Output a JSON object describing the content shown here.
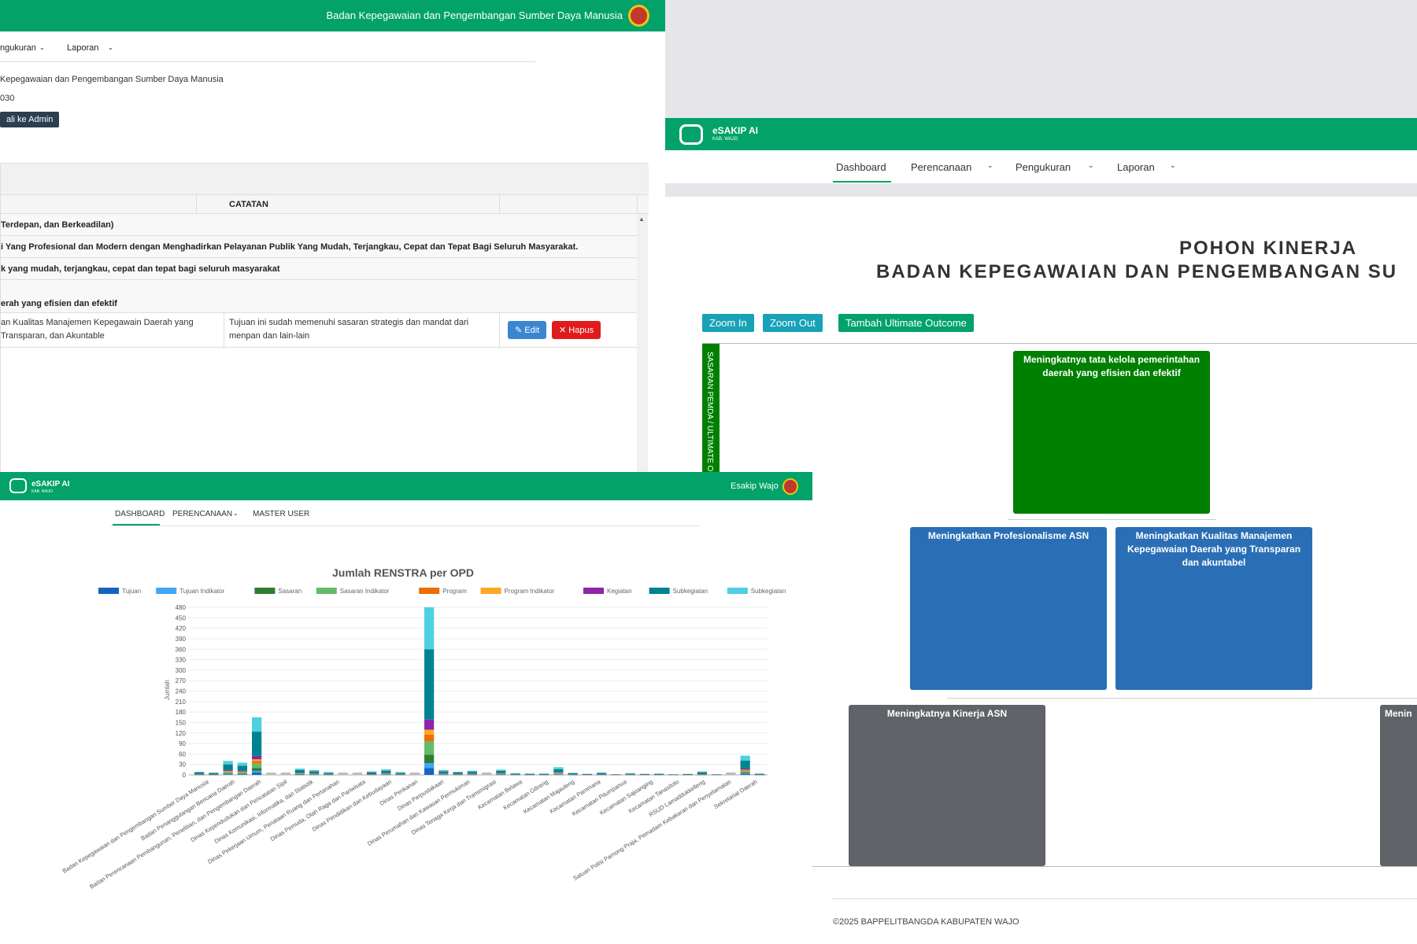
{
  "win1": {
    "brand_title": "Badan Kepegawaian dan Pengembangan Sumber Daya Manusia",
    "nav": [
      "ngukuran",
      "Laporan"
    ],
    "info_org": "Kepegawaian dan Pengembangan Sumber Daya Manusia",
    "info_year": "030",
    "back_button": "ali ke Admin",
    "col_catatan": "CATATAN",
    "rows": [
      "Terdepan, dan Berkeadilan)",
      "i Yang Profesional dan Modern dengan Menghadirkan Pelayanan Publik Yang Mudah, Terjangkau, Cepat dan Tepat Bagi Seluruh Masyarakat.",
      "k yang mudah, terjangkau, cepat dan tepat bagi seluruh masyarakat",
      "erah yang efisien dan efektif"
    ],
    "detail_left_1": "an Kualitas Manajemen Kepegawain Daerah yang",
    "detail_left_2": "Transparan, dan Akuntable",
    "detail_note_1": "Tujuan ini sudah memenuhi sasaran strategis dan mandat dari",
    "detail_note_2": "menpan dan lain-lain",
    "edit_label": "Edit",
    "delete_label": "Hapus"
  },
  "win2": {
    "logo": "eSAKIP AI",
    "logo_sub": "KAB. WAJO",
    "nav": [
      "Dashboard",
      "Perencanaan",
      "Pengukuran",
      "Laporan"
    ],
    "title_1": "POHON KINERJA",
    "title_2": "BADAN KEPEGAWAIAN DAN PENGEMBANGAN SU",
    "zoom_in": "Zoom In",
    "zoom_out": "Zoom Out",
    "add_outcome": "Tambah Ultimate Outcome",
    "vertical_label": "SASARAN PEMDA / ULTIMATE O",
    "node_root": "Meningkatnya tata kelola pemerintahan daerah yang efisien dan efektif",
    "node_a": "Meningkatkan Profesionalisme ASN",
    "node_b": "Meningkatkan Kualitas Manajemen Kepegawaian Daerah yang Transparan dan akuntabel",
    "node_c": "Meningkatnya Kinerja ASN",
    "node_d": "Menin",
    "footer": "©2025 BAPPELITBANGDA KABUPATEN WAJO",
    "colors": {
      "green": "#02a26a",
      "root": "#008000",
      "blue": "#2a6fb5",
      "gray": "#5f6368"
    }
  },
  "win3": {
    "logo": "eSAKIP AI",
    "logo_sub": "KAB. WAJO",
    "user": "Esakip Wajo",
    "menu": [
      "DASHBOARD",
      "PERENCANAAN",
      "MASTER USER"
    ]
  },
  "chart_data": {
    "type": "bar",
    "stacked": true,
    "title": "Jumlah RENSTRA per OPD",
    "ylabel": "Jumlah",
    "ylim": [
      0,
      480
    ],
    "yticks": [
      0,
      30,
      60,
      90,
      120,
      150,
      180,
      210,
      240,
      270,
      300,
      330,
      360,
      390,
      420,
      450,
      480
    ],
    "legend": [
      "Tujuan",
      "Tujuan Indikator",
      "Sasaran",
      "Sasaran Indikator",
      "Program",
      "Program Indikator",
      "Kegiatan",
      "Subkegiatan",
      "Subkegiatan Indikator"
    ],
    "colors": [
      "#1565c0",
      "#42a5f5",
      "#2e7d32",
      "#66bb6a",
      "#ef6c00",
      "#ffa726",
      "#8e24aa",
      "#00838f",
      "#4dd0e1"
    ],
    "categories": [
      "Badan Kepegawaian dan Pengembangan Sumber Daya Manusia",
      "Badan Penanggulangan Bencana Daerah",
      "Badan Perencanaan Pembangunan, Penelitian, dan Pengembangan Daerah",
      "Dinas Kependudukan dan Pencatatan Sipil",
      "Dinas Komunikasi, Informatika, dan Statistik",
      "Dinas Pekerjaan Umum, Penataan Ruang dan Pertanahan",
      "Dinas Pemuda, Olah Raga dan Pariwisata",
      "Dinas Pendidikan dan Kebudayaan",
      "Dinas Perikanan",
      "Dinas Perpustakaan",
      "Dinas Perumahan dan Kawasan Permukiman",
      "Dinas Tenaga Kerja dan Transmigrasi",
      "Kecamatan Belawa",
      "Kecamatan Gilireng",
      "Kecamatan Majauleng",
      "Kecamatan Pammana",
      "Kecamatan Pitumpanua",
      "Kecamatan Sajoanging",
      "Kecamatan Tanasitolo",
      "RSUD Lamaddukkelleng",
      "Satuan Polisi Pamong Praja, Pemadam Kebakaran dan Penyelamatan",
      "Sekretariat Daerah"
    ],
    "series_totals": [
      9,
      7,
      40,
      35,
      165,
      0,
      0,
      18,
      14,
      8,
      0,
      0,
      10,
      16,
      8,
      0,
      480,
      14,
      9,
      12,
      0,
      15,
      5,
      4,
      4,
      22,
      6,
      3,
      7,
      2,
      5,
      3,
      4,
      2,
      3,
      10,
      2,
      0,
      55,
      4
    ]
  }
}
